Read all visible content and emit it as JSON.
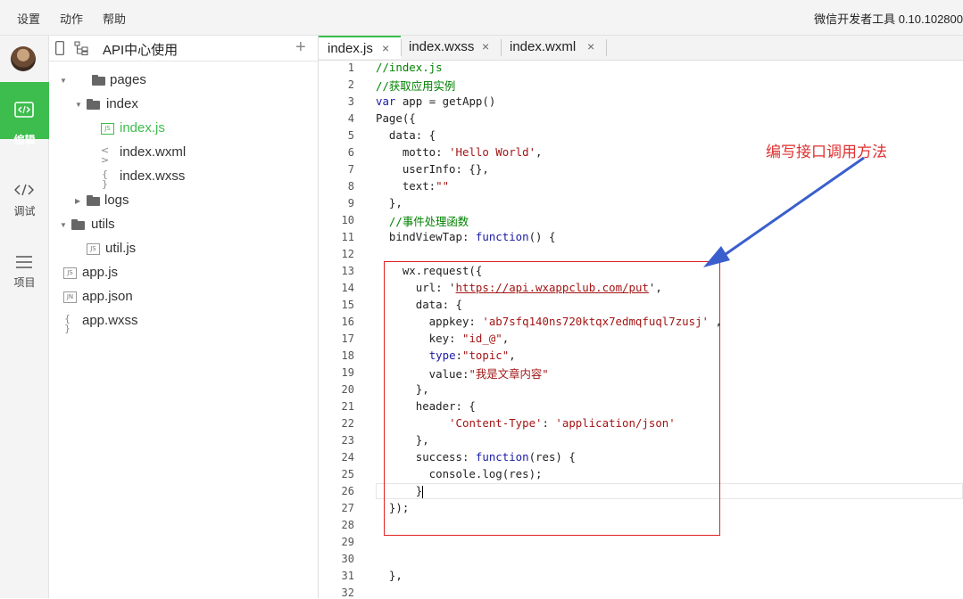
{
  "menubar": {
    "items": [
      "设置",
      "动作",
      "帮助"
    ],
    "app_title": "微信开发者工具 0.10.102800"
  },
  "sidebar": {
    "nav": [
      {
        "label": "编辑",
        "icon": "code-edit-icon",
        "active": true
      },
      {
        "label": "调试",
        "icon": "debug-code-icon",
        "active": false
      },
      {
        "label": "项目",
        "icon": "menu-list-icon",
        "active": false
      }
    ]
  },
  "filepanel": {
    "title": "API中心使用",
    "add_icon": "+",
    "tree": [
      {
        "name": "pages",
        "type": "folder",
        "expanded": true
      },
      {
        "name": "index",
        "type": "folder",
        "expanded": true
      },
      {
        "name": "index.js",
        "type": "js",
        "selected": true
      },
      {
        "name": "index.wxml",
        "type": "wxml"
      },
      {
        "name": "index.wxss",
        "type": "wxss"
      },
      {
        "name": "logs",
        "type": "folder",
        "expanded": false
      },
      {
        "name": "utils",
        "type": "folder",
        "expanded": true
      },
      {
        "name": "util.js",
        "type": "js"
      },
      {
        "name": "app.js",
        "type": "js"
      },
      {
        "name": "app.json",
        "type": "json"
      },
      {
        "name": "app.wxss",
        "type": "wxss"
      }
    ],
    "icon_labels": {
      "js": "JS",
      "json": "JN",
      "wxml": "< >",
      "wxss": "{ }"
    }
  },
  "editor": {
    "tabs": [
      {
        "name": "index.js",
        "active": true
      },
      {
        "name": "index.wxss",
        "active": false
      },
      {
        "name": "index.wxml",
        "active": false
      }
    ],
    "close_glyph": "×",
    "line_numbers": [
      "1",
      "2",
      "3",
      "4",
      "5",
      "6",
      "7",
      "8",
      "9",
      "10",
      "11",
      "12",
      "13",
      "14",
      "15",
      "16",
      "17",
      "18",
      "19",
      "20",
      "21",
      "22",
      "23",
      "24",
      "25",
      "26",
      "27",
      "28",
      "29",
      "30",
      "31",
      "32"
    ],
    "code": {
      "l1": "//index.js",
      "l2": "//获取应用实例",
      "l3a": "var",
      "l3b": " app = getApp()",
      "l4": "Page({",
      "l5": "  data: {",
      "l6a": "    motto: ",
      "l6b": "'Hello World'",
      "l6c": ",",
      "l7": "    userInfo: {},",
      "l8a": "    text:",
      "l8b": "\"\"",
      "l9": "  },",
      "l10": "  //事件处理函数",
      "l11a": "  bindViewTap: ",
      "l11b": "function",
      "l11c": "() {",
      "l12": "",
      "l13": "    wx.request({",
      "l14a": "      url: '",
      "l14b": "https://api.wxappclub.com/put",
      "l14c": "',",
      "l15": "      data: {",
      "l16a": "        appkey: ",
      "l16b": "'ab7sfq140ns720ktqx7edmqfuql7zusj'",
      "l16c": " ,",
      "l17a": "        key: ",
      "l17b": "\"id_@\"",
      "l17c": ",",
      "l18a": "        ",
      "l18b": "type",
      "l18c": ":",
      "l18d": "\"topic\"",
      "l18e": ",",
      "l19a": "        value:",
      "l19b": "\"我是文章内容\"",
      "l20": "      },",
      "l21": "      header: {",
      "l22a": "           ",
      "l22b": "'Content-Type'",
      "l22c": ": ",
      "l22d": "'application/json'",
      "l23": "      },",
      "l24a": "      success: ",
      "l24b": "function",
      "l24c": "(res) {",
      "l25": "        console.log(res);",
      "l26": "      }",
      "l27": "  });",
      "l28": "",
      "l29": "",
      "l30": "",
      "l31": "  },",
      "l32": ""
    }
  },
  "annotation": {
    "text": "编写接口调用方法",
    "color": "#e03030"
  },
  "colors": {
    "accent": "#3dbd4d",
    "annotation_box": "#e02020",
    "arrow": "#3a5fcd"
  }
}
